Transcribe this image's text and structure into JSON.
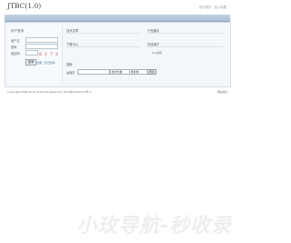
{
  "site": {
    "title": "JTBC(1.0)"
  },
  "top_links": [
    "设为首页",
    "加入收藏"
  ],
  "nav": [
    "首页",
    "技术文章",
    "产品展示",
    "下载中心",
    "视频频道",
    "在线留言"
  ],
  "login": {
    "title": "用户登录",
    "username_label": "用户名",
    "password_label": "密码",
    "captcha_label": "验证码",
    "captcha_text": "8 1 7 3",
    "submit_label": "登录",
    "register_link": "注册",
    "forgot_link": "忘记密码"
  },
  "sections": {
    "articles": "技术文章",
    "products": "产品展示",
    "downloads": "下载中心",
    "online": "在线用户",
    "online_count": "0人在线",
    "search": "搜索"
  },
  "search": {
    "keyword_label": "关键字",
    "keyword_value": "",
    "module_select": "技术文章",
    "field_select": "按标题",
    "button_label": "搜索"
  },
  "footer": {
    "copyright": "Copyright 2008-2010 All Rights Reserved.  沪ICP备10005272号-1",
    "right": "网站统计"
  },
  "watermark": "小玫导航-秒收录"
}
